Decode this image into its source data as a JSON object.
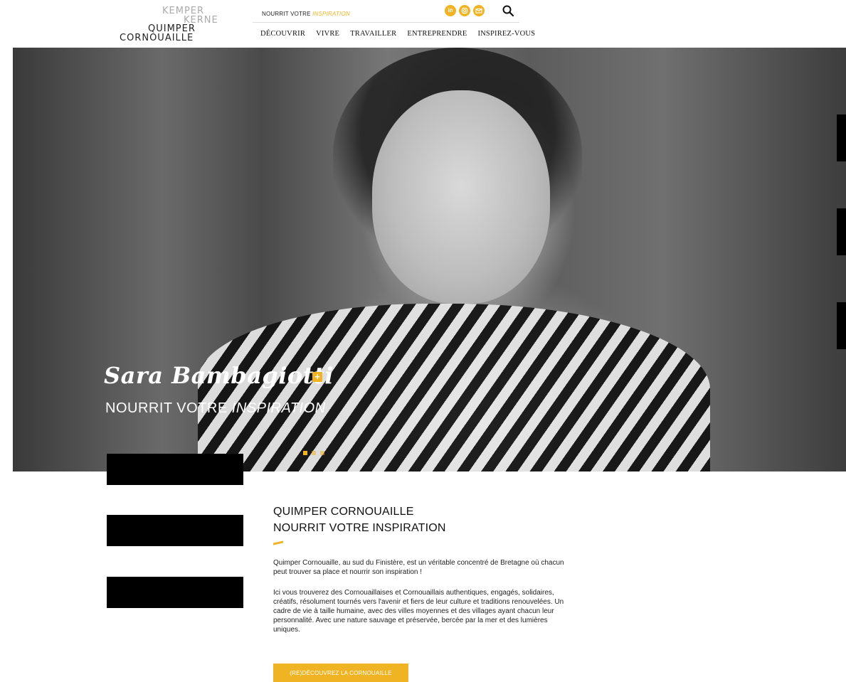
{
  "header": {
    "logo": {
      "line1": "KEMPER",
      "line2": "KERNE",
      "line3": "QUIMPER",
      "line4": "CORNOUAILLE"
    },
    "tagline": {
      "prefix": "NOURRIT VOTRE",
      "highlight": "INSPIRATION"
    },
    "social_icons": [
      "linkedin-icon",
      "instagram-icon",
      "email-icon"
    ],
    "search_icon": "search-icon",
    "nav": [
      "DÉCOUVRIR",
      "VIVRE",
      "TRAVAILLER",
      "ENTREPRENDRE",
      "INSPIREZ-VOUS"
    ]
  },
  "hero": {
    "name": "Sara Bambagiotti",
    "plus_label": "+",
    "subtitle_prefix": "NOURRIT VOTRE",
    "subtitle_highlight": "INSPIRATION",
    "slides_count": 3,
    "active_slide": 1
  },
  "intro": {
    "title_line1": "QUIMPER CORNOUAILLE",
    "title_line2": "NOURRIT VOTRE INSPIRATION",
    "paragraph1": "Quimper Cornouaille, au sud du Finistère, est un véritable concentré de Bretagne où chacun peut trouver sa place et nourrir son inspiration !",
    "paragraph2": "Ici vous trouverez des Cornouaillaises et Cornouaillais authentiques, engagés, solidaires, créatifs, résolument tournés vers l'avenir et fiers de leur culture et traditions renouvelées. Un cadre de vie à taille humaine, avec des villes moyennes et des villages ayant chacun leur personnalité. Avec une nature sauvage et préservée, bercée par la mer et des lumières uniques.",
    "cta_label": "(RE)DÉCOUVREZ LA CORNOUAILLE"
  },
  "colors": {
    "accent": "#f0b323",
    "text": "#222222"
  }
}
